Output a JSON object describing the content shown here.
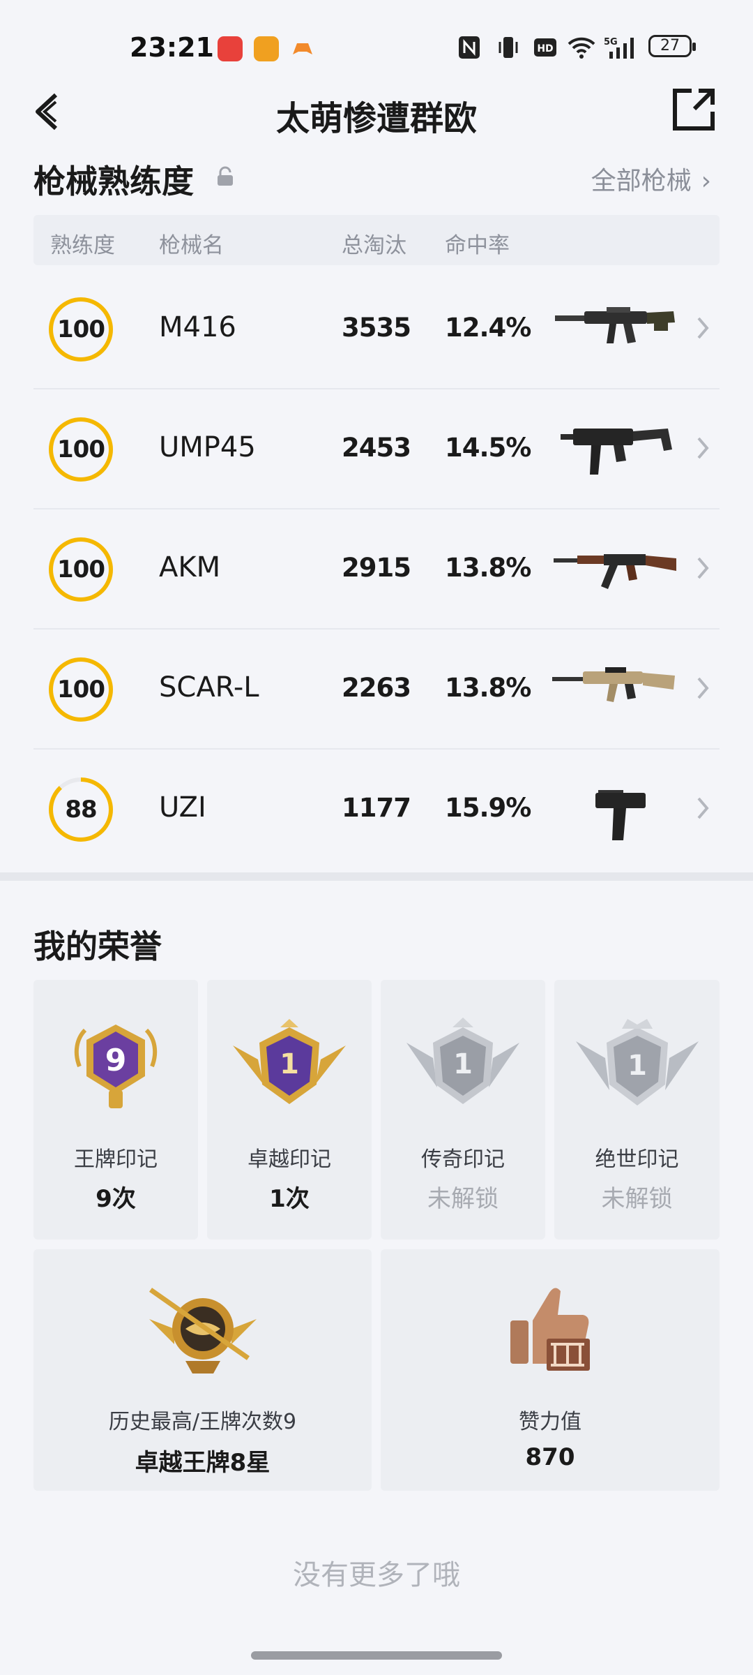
{
  "status": {
    "time": "23:21",
    "battery": "27"
  },
  "header": {
    "title": "太萌惨遭群欧"
  },
  "weapons": {
    "section_title": "枪械熟练度",
    "all_link": "全部枪械",
    "columns": [
      "熟练度",
      "枪械名",
      "总淘汰",
      "命中率"
    ],
    "rows": [
      {
        "proficiency": 100,
        "name": "M416",
        "kills": "3535",
        "hit_rate": "12.4%"
      },
      {
        "proficiency": 100,
        "name": "UMP45",
        "kills": "2453",
        "hit_rate": "14.5%"
      },
      {
        "proficiency": 100,
        "name": "AKM",
        "kills": "2915",
        "hit_rate": "13.8%"
      },
      {
        "proficiency": 100,
        "name": "SCAR-L",
        "kills": "2263",
        "hit_rate": "13.8%"
      },
      {
        "proficiency": 88,
        "name": "UZI",
        "kills": "1177",
        "hit_rate": "15.9%"
      }
    ]
  },
  "honors": {
    "section_title": "我的荣誉",
    "badges": [
      {
        "badge_number": "9",
        "label": "王牌印记",
        "value": "9次"
      },
      {
        "badge_number": "1",
        "label": "卓越印记",
        "value": "1次"
      },
      {
        "badge_number": "1",
        "label": "传奇印记",
        "value": "未解锁"
      },
      {
        "badge_number": "1",
        "label": "绝世印记",
        "value": "未解锁"
      }
    ],
    "history": {
      "label": "历史最高/王牌次数9",
      "value": "卓越王牌8星"
    },
    "likes": {
      "label": "赞力值",
      "value": "870"
    }
  },
  "footer": {
    "no_more": "没有更多了哦"
  },
  "colors": {
    "ring": "#f5b800",
    "gold": "#d7a53a",
    "purple": "#6b3fa0",
    "silver": "#a9adb4",
    "bronze": "#b07a5a"
  }
}
